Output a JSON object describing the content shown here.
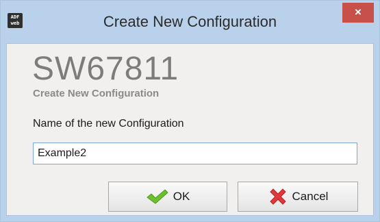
{
  "window": {
    "title": "Create New Configuration",
    "app_icon_text": [
      "ADF",
      "web"
    ],
    "close_label": "×"
  },
  "content": {
    "product_code": "SW67811",
    "subtitle": "Create New Configuration",
    "field_label": "Name of the new Configuration",
    "name_value": "Example2"
  },
  "buttons": {
    "ok_label": "OK",
    "ok_icon": "checkmark-icon",
    "cancel_label": "Cancel",
    "cancel_icon": "red-x-icon"
  },
  "colors": {
    "titlebar": "#b9d1ea",
    "close_button": "#c7504a",
    "client_background": "#f1f0ee",
    "ok_icon": "#6cbf2f",
    "cancel_icon": "#e0383c"
  }
}
